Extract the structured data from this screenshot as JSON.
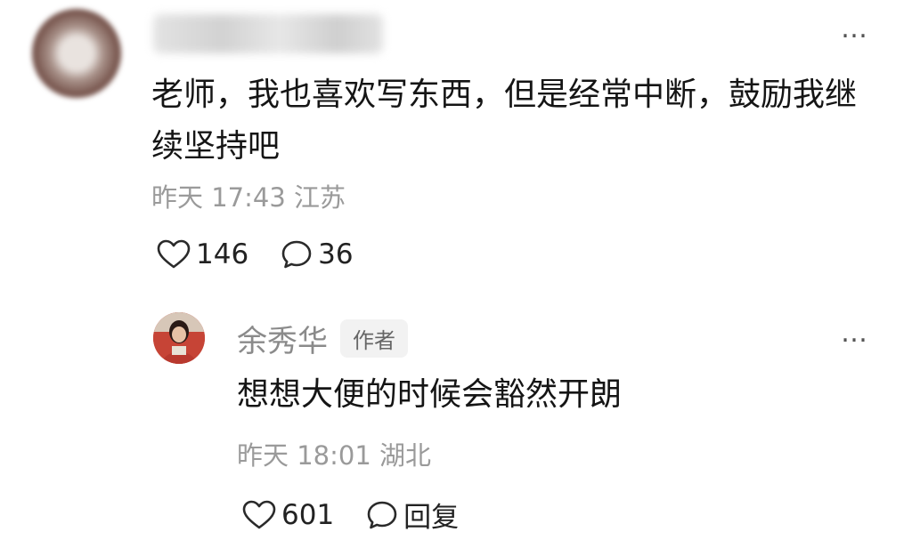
{
  "comment": {
    "text": "老师，我也喜欢写东西，但是经常中断，鼓励我继续坚持吧",
    "time": "昨天 17:43",
    "location": "江苏",
    "likes": "146",
    "replies": "36",
    "more_icon": "…"
  },
  "reply": {
    "author": "余秀华",
    "badge": "作者",
    "text": "想想大便的时候会豁然开朗",
    "time": "昨天 18:01",
    "location": "湖北",
    "likes": "601",
    "reply_label": "回复",
    "more_icon": "…"
  },
  "icons": {
    "like": "heart-outline-icon",
    "comment": "speech-bubble-icon",
    "more": "ellipsis-icon"
  },
  "colors": {
    "text": "#151515",
    "meta": "#9a9a9a",
    "author": "#8a8a8a",
    "badge_bg": "#f2f2f2"
  }
}
